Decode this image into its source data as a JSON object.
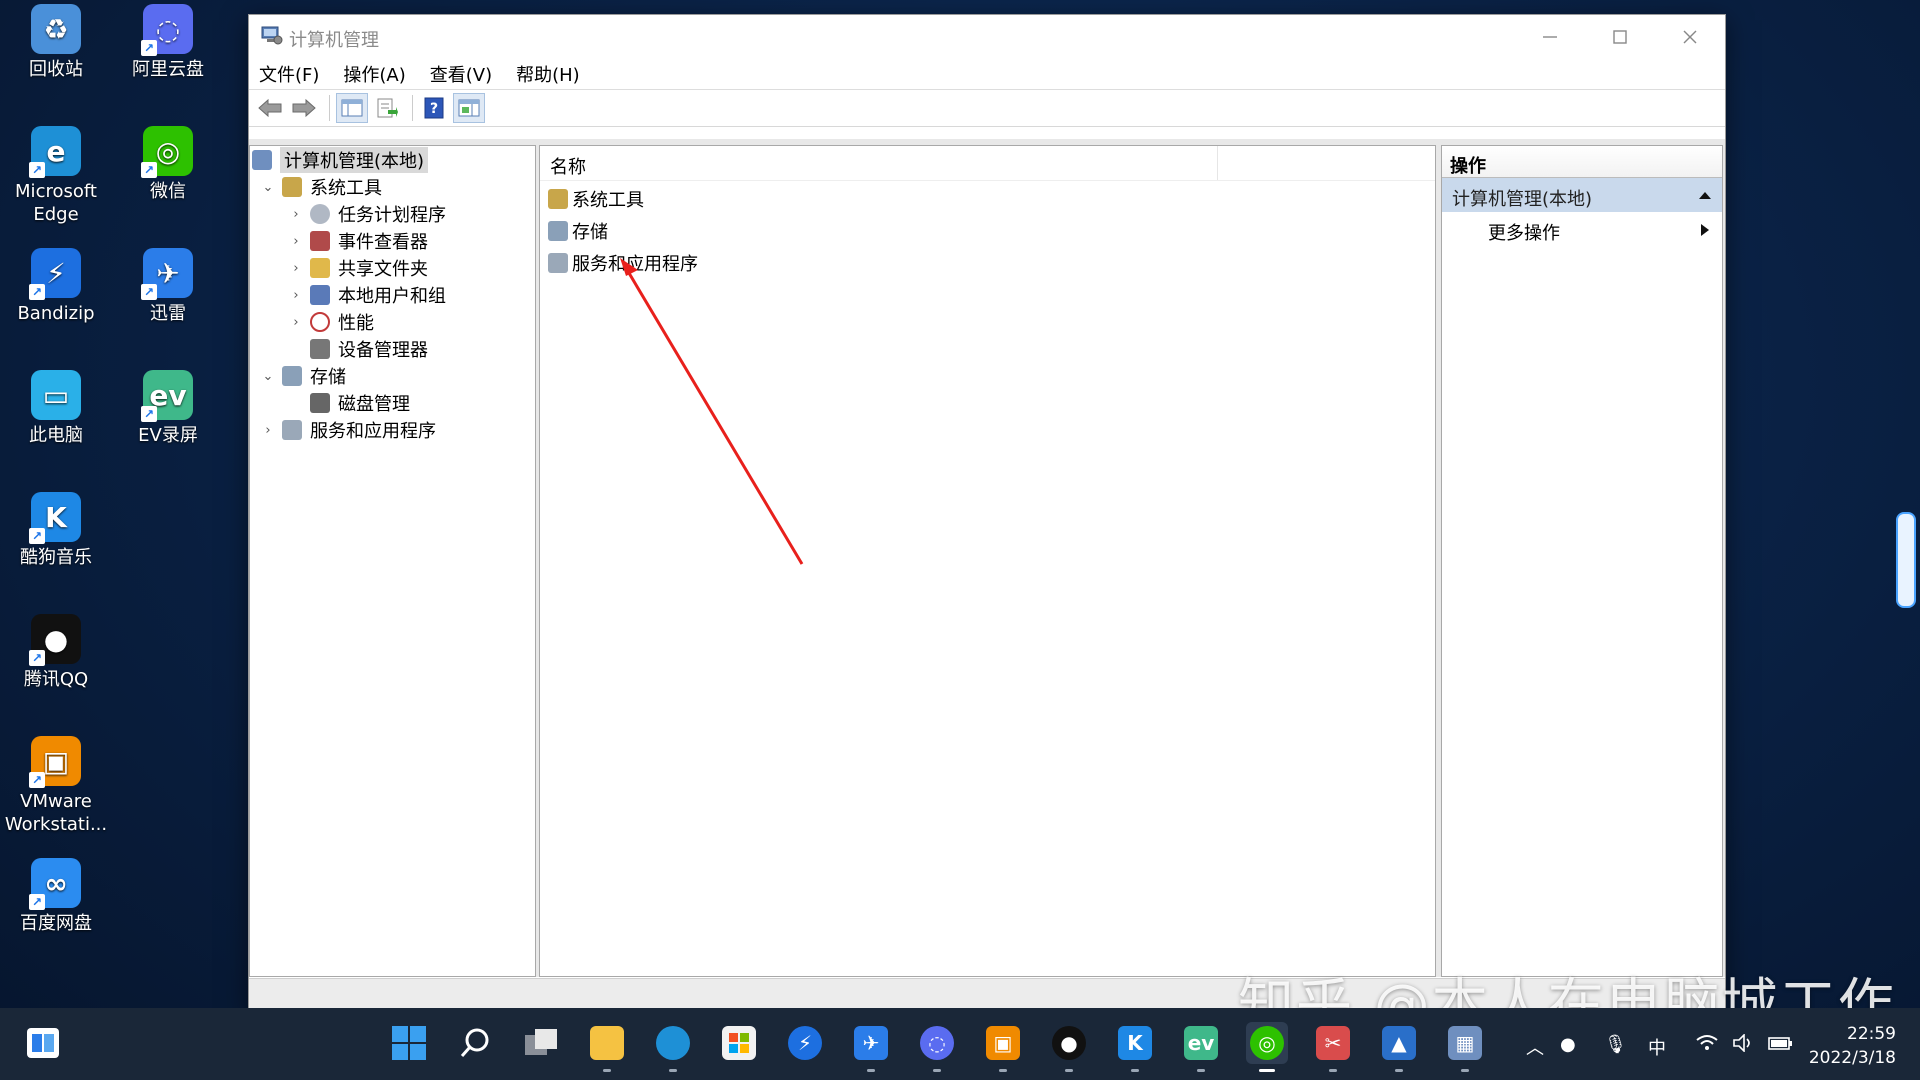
{
  "desktop": {
    "icons": [
      {
        "label": "回收站",
        "icon": "recycle-bin-icon",
        "color": "#4a90d9"
      },
      {
        "label": "阿里云盘",
        "icon": "aliyun-drive-icon",
        "color": "#5a6cf0"
      },
      {
        "label": "Microsoft Edge",
        "icon": "edge-icon",
        "color": "#1e90d6"
      },
      {
        "label": "微信",
        "icon": "wechat-icon",
        "color": "#2dc100"
      },
      {
        "label": "Bandizip",
        "icon": "bandizip-icon",
        "color": "#1d6fe0"
      },
      {
        "label": "迅雷",
        "icon": "thunder-icon",
        "color": "#2b7de9"
      },
      {
        "label": "此电脑",
        "icon": "this-pc-icon",
        "color": "#2ab0e8"
      },
      {
        "label": "EV录屏",
        "icon": "ev-recorder-icon",
        "color": "#3fb88a"
      },
      {
        "label": "酷狗音乐",
        "icon": "kugou-icon",
        "color": "#1e88e5"
      },
      {
        "label": "腾讯QQ",
        "icon": "qq-icon",
        "color": "#111111"
      },
      {
        "label": "VMware Workstati...",
        "icon": "vmware-icon",
        "color": "#f08a00"
      },
      {
        "label": "百度网盘",
        "icon": "baidu-netdisk-icon",
        "color": "#2b8cf0"
      }
    ]
  },
  "window": {
    "title": "计算机管理",
    "menu": [
      "文件(F)",
      "操作(A)",
      "查看(V)",
      "帮助(H)"
    ],
    "tree": {
      "root": "计算机管理(本地)",
      "system_tools": "系统工具",
      "task_scheduler": "任务计划程序",
      "event_viewer": "事件查看器",
      "shared_folders": "共享文件夹",
      "local_users": "本地用户和组",
      "performance": "性能",
      "device_manager": "设备管理器",
      "storage": "存储",
      "disk_management": "磁盘管理",
      "services_apps": "服务和应用程序"
    },
    "list": {
      "column_name": "名称",
      "items": [
        "系统工具",
        "存储",
        "服务和应用程序"
      ]
    },
    "actions": {
      "header": "操作",
      "section": "计算机管理(本地)",
      "more": "更多操作"
    }
  },
  "taskbar": {
    "ime": "中",
    "time": "22:59",
    "date": "2022/3/18"
  },
  "watermark": "知乎 @本人在电脑城工作",
  "colors": {
    "arrow": "#e8201c",
    "selection": "#d9d9d9",
    "action_section": "#c9d9ec"
  }
}
